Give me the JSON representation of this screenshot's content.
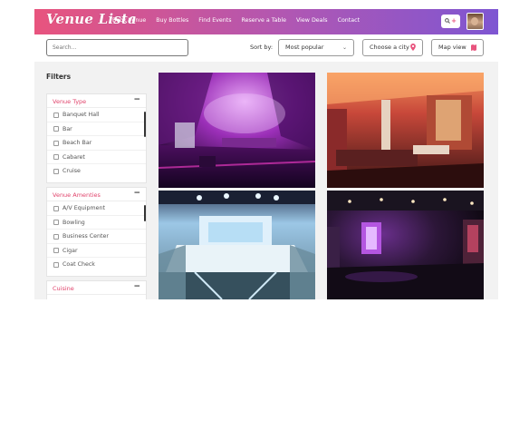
{
  "header": {
    "logo": "Venue Lista",
    "nav": [
      "Book Venue",
      "Buy Bottles",
      "Find Events",
      "Reserve a Table",
      "View Deals",
      "Contact"
    ],
    "search_icon": "search-icon",
    "plus_icon": "plus-icon"
  },
  "toolbar": {
    "search_placeholder": "Search...",
    "sort_label": "Sort by:",
    "sort_value": "Most popular",
    "city_label": "Choose a city",
    "map_label": "Map view"
  },
  "sidebar": {
    "title": "Filters",
    "sections": [
      {
        "title": "Venue Type",
        "toggle": "−",
        "options": [
          "Banquet Hall",
          "Bar",
          "Beach Bar",
          "Cabaret",
          "Cruise"
        ]
      },
      {
        "title": "Venue Amenties",
        "toggle": "−",
        "options": [
          "A/V Equipment",
          "Bowling",
          "Business Center",
          "Cigar",
          "Coat Check"
        ]
      },
      {
        "title": "Cuisine",
        "toggle": "−",
        "options": []
      }
    ]
  },
  "colors": {
    "brand_pink": "#e8547e",
    "brand_purple": "#7e56d2",
    "section_title": "#e0436b"
  },
  "venues": [
    {
      "photo": "nightclub-purple-lounge"
    },
    {
      "photo": "lounge-red-lighting"
    },
    {
      "photo": "white-club-blue-lights"
    },
    {
      "photo": "dark-club-stage"
    }
  ]
}
